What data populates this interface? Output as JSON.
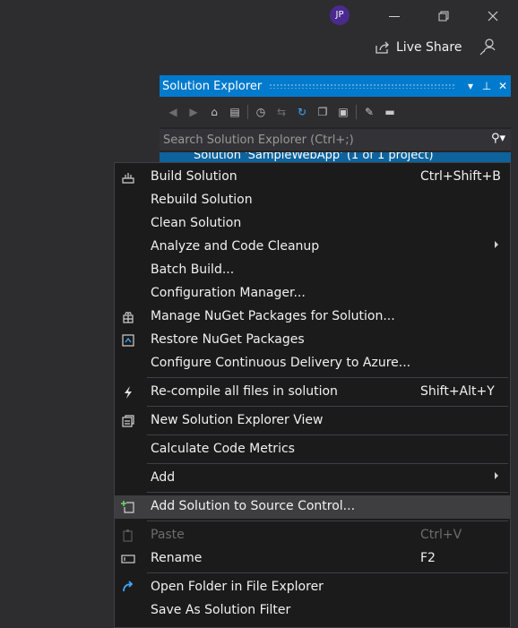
{
  "titlebar": {
    "avatar_initials": "JP",
    "minimize_icon": "minimize-icon",
    "maximize_icon": "restore-icon",
    "close_icon": "close-icon"
  },
  "liveshare": {
    "label": "Live Share",
    "icon": "share-icon",
    "feedback_icon": "feedback-icon"
  },
  "solution_explorer": {
    "title": "Solution Explorer",
    "title_controls": [
      "▾",
      "⊥",
      "✕"
    ],
    "search_placeholder": "Search Solution Explorer (Ctrl+;)",
    "partial_row_text": "Solution 'SampleWebApp' (1 of 1 project)"
  },
  "context_menu": {
    "items": [
      {
        "label": "Build Solution",
        "shortcut": "Ctrl+Shift+B",
        "icon": "build-icon"
      },
      {
        "label": "Rebuild Solution",
        "shortcut": ""
      },
      {
        "label": "Clean Solution",
        "shortcut": ""
      },
      {
        "label": "Analyze and Code Cleanup",
        "shortcut": "",
        "submenu": true
      },
      {
        "label": "Batch Build...",
        "shortcut": ""
      },
      {
        "label": "Configuration Manager...",
        "shortcut": ""
      },
      {
        "label": "Manage NuGet Packages for Solution...",
        "shortcut": "",
        "icon": "nuget-icon"
      },
      {
        "label": "Restore NuGet Packages",
        "shortcut": "",
        "icon": "restore-icon"
      },
      {
        "label": "Configure Continuous Delivery to Azure...",
        "shortcut": ""
      },
      {
        "label": "Re-compile all files in solution",
        "shortcut": "Shift+Alt+Y",
        "icon": "lightning-icon"
      },
      {
        "label": "New Solution Explorer View",
        "shortcut": "",
        "icon": "new-view-icon"
      },
      {
        "label": "Calculate Code Metrics",
        "shortcut": ""
      },
      {
        "label": "Add",
        "shortcut": "",
        "submenu": true
      },
      {
        "label": "Add Solution to Source Control...",
        "shortcut": "",
        "icon": "add-source-control-icon",
        "highlighted": true
      },
      {
        "label": "Paste",
        "shortcut": "Ctrl+V",
        "icon": "paste-icon",
        "disabled": true
      },
      {
        "label": "Rename",
        "shortcut": "F2",
        "icon": "rename-icon"
      },
      {
        "label": "Open Folder in File Explorer",
        "shortcut": "",
        "icon": "open-folder-icon"
      },
      {
        "label": "Save As Solution Filter",
        "shortcut": ""
      }
    ]
  },
  "colors": {
    "accent": "#007acc",
    "background": "#2d2d30",
    "menu_background": "#1b1b1c",
    "highlight": "#3e3e40"
  }
}
